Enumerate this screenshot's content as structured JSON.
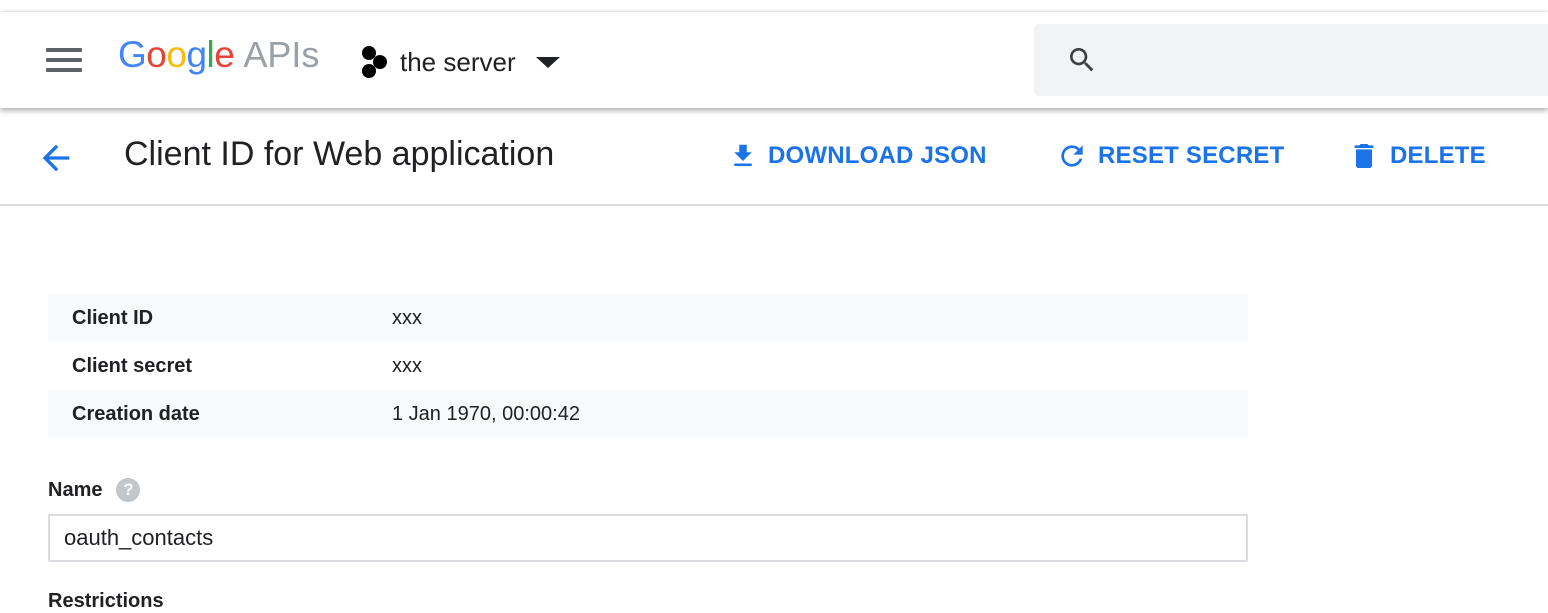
{
  "header": {
    "logo_letters": [
      {
        "char": "G",
        "color": "#4285F4"
      },
      {
        "char": "o",
        "color": "#EA4335"
      },
      {
        "char": "o",
        "color": "#FBBC05"
      },
      {
        "char": "g",
        "color": "#4285F4"
      },
      {
        "char": "l",
        "color": "#34A853"
      },
      {
        "char": "e",
        "color": "#EA4335"
      }
    ],
    "logo_suffix": "APIs",
    "project_name": "the server",
    "menu_icon": "hamburger-menu-icon",
    "search_icon": "search-icon"
  },
  "toolbar": {
    "title": "Client ID for Web application",
    "download_label": "DOWNLOAD JSON",
    "reset_label": "RESET SECRET",
    "delete_label": "DELETE",
    "accent_color": "#1a73e8"
  },
  "details": [
    {
      "label": "Client ID",
      "value": "xxx"
    },
    {
      "label": "Client secret",
      "value": "xxx"
    },
    {
      "label": "Creation date",
      "value": "1 Jan 1970, 00:00:42"
    }
  ],
  "name_field": {
    "label": "Name",
    "help_glyph": "?",
    "value": "oauth_contacts"
  },
  "restrictions_label": "Restrictions"
}
